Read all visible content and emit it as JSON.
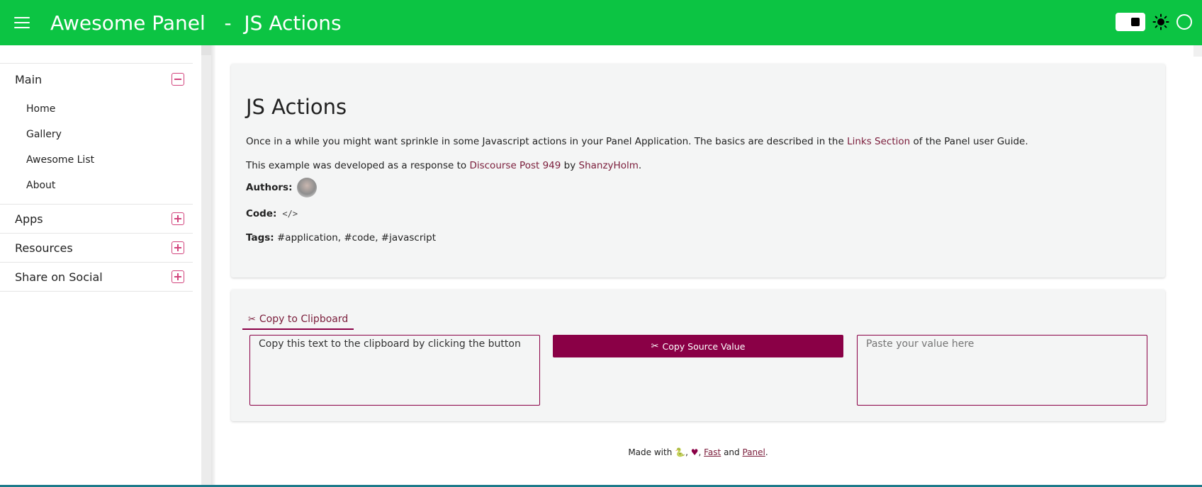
{
  "header": {
    "title": "Awesome Panel   -  JS Actions",
    "menu_icon": "hamburger-icon",
    "theme_toggle_icon": "toggle-icon",
    "sun_icon": "sun-icon",
    "circle_icon": "circle-icon"
  },
  "sidebar": {
    "groups": [
      {
        "label": "Main",
        "expanded": true,
        "items": [
          "Home",
          "Gallery",
          "Awesome List",
          "About"
        ]
      },
      {
        "label": "Apps",
        "expanded": false
      },
      {
        "label": "Resources",
        "expanded": false
      },
      {
        "label": "Share on Social",
        "expanded": false
      }
    ]
  },
  "info": {
    "title": "JS Actions",
    "intro_prefix": "Once in a while you might want sprinkle in some Javascript actions in your Panel Application. The basics are described in the ",
    "intro_link": "Links Section",
    "intro_suffix": " of the Panel user Guide.",
    "example_prefix": "This example was developed as a response to ",
    "example_link": "Discourse Post 949",
    "example_by": " by ",
    "example_author": "ShanzyHolm",
    "example_end": ".",
    "authors_label": "Authors:",
    "code_label": "Code:",
    "code_icon": "</>",
    "tags_label": "Tags:",
    "tags": " #application, #code, #javascript"
  },
  "tools": {
    "tab_icon": "✂",
    "tab_label": "Copy to Clipboard",
    "source_value": "Copy this text to the clipboard by clicking the button",
    "button_icon": "✂",
    "button_label": "Copy Source Value",
    "target_placeholder": "Paste your value here"
  },
  "footer": {
    "made_with": "Made with ",
    "python": "🐍",
    "comma1": ", ",
    "heart": "♥",
    "comma2": ", ",
    "fast": "Fast",
    "and": " and ",
    "panel": "Panel",
    "end": "."
  },
  "colors": {
    "header_green": "#0cc443",
    "accent": "#8a0046",
    "link": "#7a1c3a"
  }
}
